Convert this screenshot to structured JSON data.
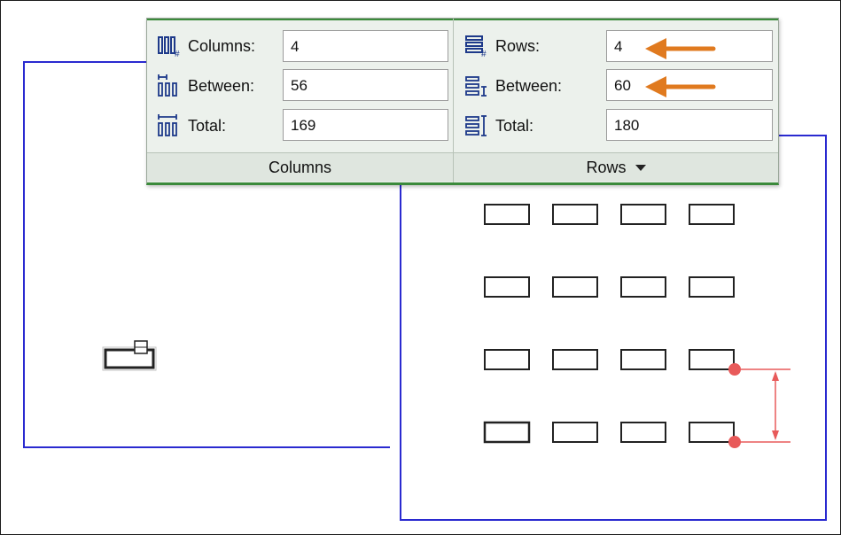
{
  "columns_panel": {
    "columns_label": "Columns:",
    "columns_value": "4",
    "between_label": "Between:",
    "between_value": "56",
    "total_label": "Total:",
    "total_value": "169",
    "footer_label": "Columns"
  },
  "rows_panel": {
    "rows_label": "Rows:",
    "rows_value": "4",
    "between_label": "Between:",
    "between_value": "60",
    "total_label": "Total:",
    "total_value": "180",
    "footer_label": "Rows"
  },
  "colors": {
    "frame_line": "#2a2ad0",
    "accent_green": "#3b8a3b",
    "arrow": "#e07a1f",
    "grip": "#e85a5a"
  },
  "icons": [
    "columns-count-icon",
    "columns-between-icon",
    "columns-total-icon",
    "rows-count-icon",
    "rows-between-icon",
    "rows-total-icon",
    "dropdown-caret-icon",
    "callout-arrow-icon"
  ]
}
